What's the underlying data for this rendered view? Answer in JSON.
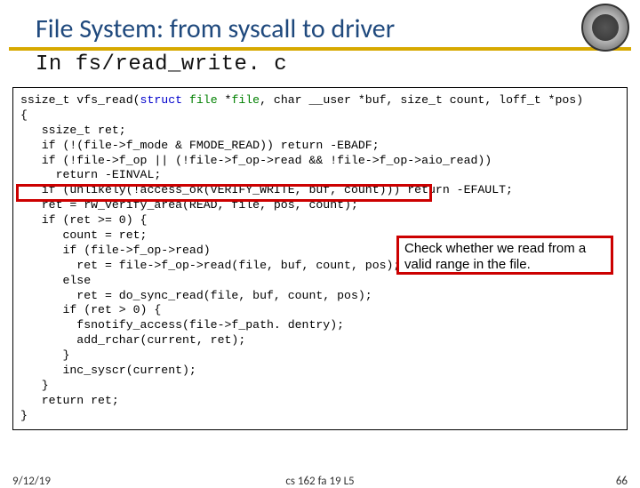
{
  "header": {
    "title": "File System: from syscall to driver",
    "subtitle": "In fs/read_write. c"
  },
  "code": {
    "l1a": "ssize_t vfs_read(",
    "l1b": "struct",
    "l1c": " ",
    "l1d": "file",
    "l1e": " *",
    "l1f": "file",
    "l1g": ", char __user *buf, size_t count, loff_t *pos)",
    "l2": "{",
    "l3": "   ssize_t ret;",
    "l4": "   if (!(file->f_mode & FMODE_READ)) return -EBADF;",
    "l5": "   if (!file->f_op || (!file->f_op->read && !file->f_op->aio_read))",
    "l6": "     return -EINVAL;",
    "l7": "   if (unlikely(!access_ok(VERIFY_WRITE, buf, count))) return -EFAULT;",
    "l8": "   ret = rw_verify_area(READ, file, pos, count);",
    "l9": "   if (ret >= 0) {",
    "l10": "      count = ret;",
    "l11": "      if (file->f_op->read)",
    "l12": "        ret = file->f_op->read(file, buf, count, pos);",
    "l13": "      else",
    "l14": "        ret = do_sync_read(file, buf, count, pos);",
    "l15": "      if (ret > 0) {",
    "l16": "        fsnotify_access(file->f_path. dentry);",
    "l17": "        add_rchar(current, ret);",
    "l18": "      }",
    "l19": "      inc_syscr(current);",
    "l20": "   }",
    "l21": "   return ret;",
    "l22": "}"
  },
  "callout": {
    "text": "Check whether we read from a valid range in the file."
  },
  "footer": {
    "date": "9/12/19",
    "mid": "cs 162 fa 19 L5",
    "page": "66"
  }
}
